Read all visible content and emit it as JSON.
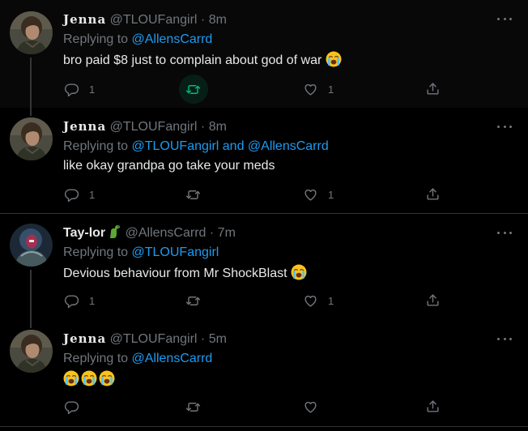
{
  "colors": {
    "background": "#000000",
    "text": "#e7e9ea",
    "muted": "#71767b",
    "link": "#1d9bf0",
    "retweet_active": "#00ba7c"
  },
  "tweets": [
    {
      "name": "Jenna",
      "handle": "@TLOUFangirl",
      "dot": "·",
      "time": "8m",
      "reply_prefix": "Replying to ",
      "reply_targets": "@AllensCarrd",
      "text": "bro paid $8 just to complain about god of war ",
      "emoji": [
        "crying-face"
      ],
      "reply_count": "1",
      "like_count": "1",
      "retweet_active": true
    },
    {
      "name": "Jenna",
      "handle": "@TLOUFangirl",
      "dot": "·",
      "time": "8m",
      "reply_prefix": "Replying to ",
      "reply_targets": "@TLOUFangirl and @AllensCarrd",
      "text": "like okay grandpa go take your meds",
      "emoji": [],
      "reply_count": "1",
      "like_count": "1",
      "retweet_active": false
    },
    {
      "name": "Tay-lor",
      "name_emoji": "dinosaur",
      "handle": "@AllensCarrd",
      "dot": "·",
      "time": "7m",
      "reply_prefix": "Replying to ",
      "reply_targets": "@TLOUFangirl",
      "text": "Devious behaviour from Mr ShockBlast ",
      "emoji": [
        "crying-face"
      ],
      "reply_count": "1",
      "like_count": "1",
      "retweet_active": false
    },
    {
      "name": "Jenna",
      "handle": "@TLOUFangirl",
      "dot": "·",
      "time": "5m",
      "reply_prefix": "Replying to ",
      "reply_targets": "@AllensCarrd",
      "text": "",
      "emoji": [
        "crying-face",
        "crying-face",
        "crying-face"
      ],
      "reply_count": "",
      "like_count": "",
      "retweet_active": false
    }
  ],
  "icons": {
    "reply": "reply-icon",
    "retweet": "retweet-icon",
    "like": "heart-icon",
    "share": "share-icon",
    "more": "more-icon"
  }
}
